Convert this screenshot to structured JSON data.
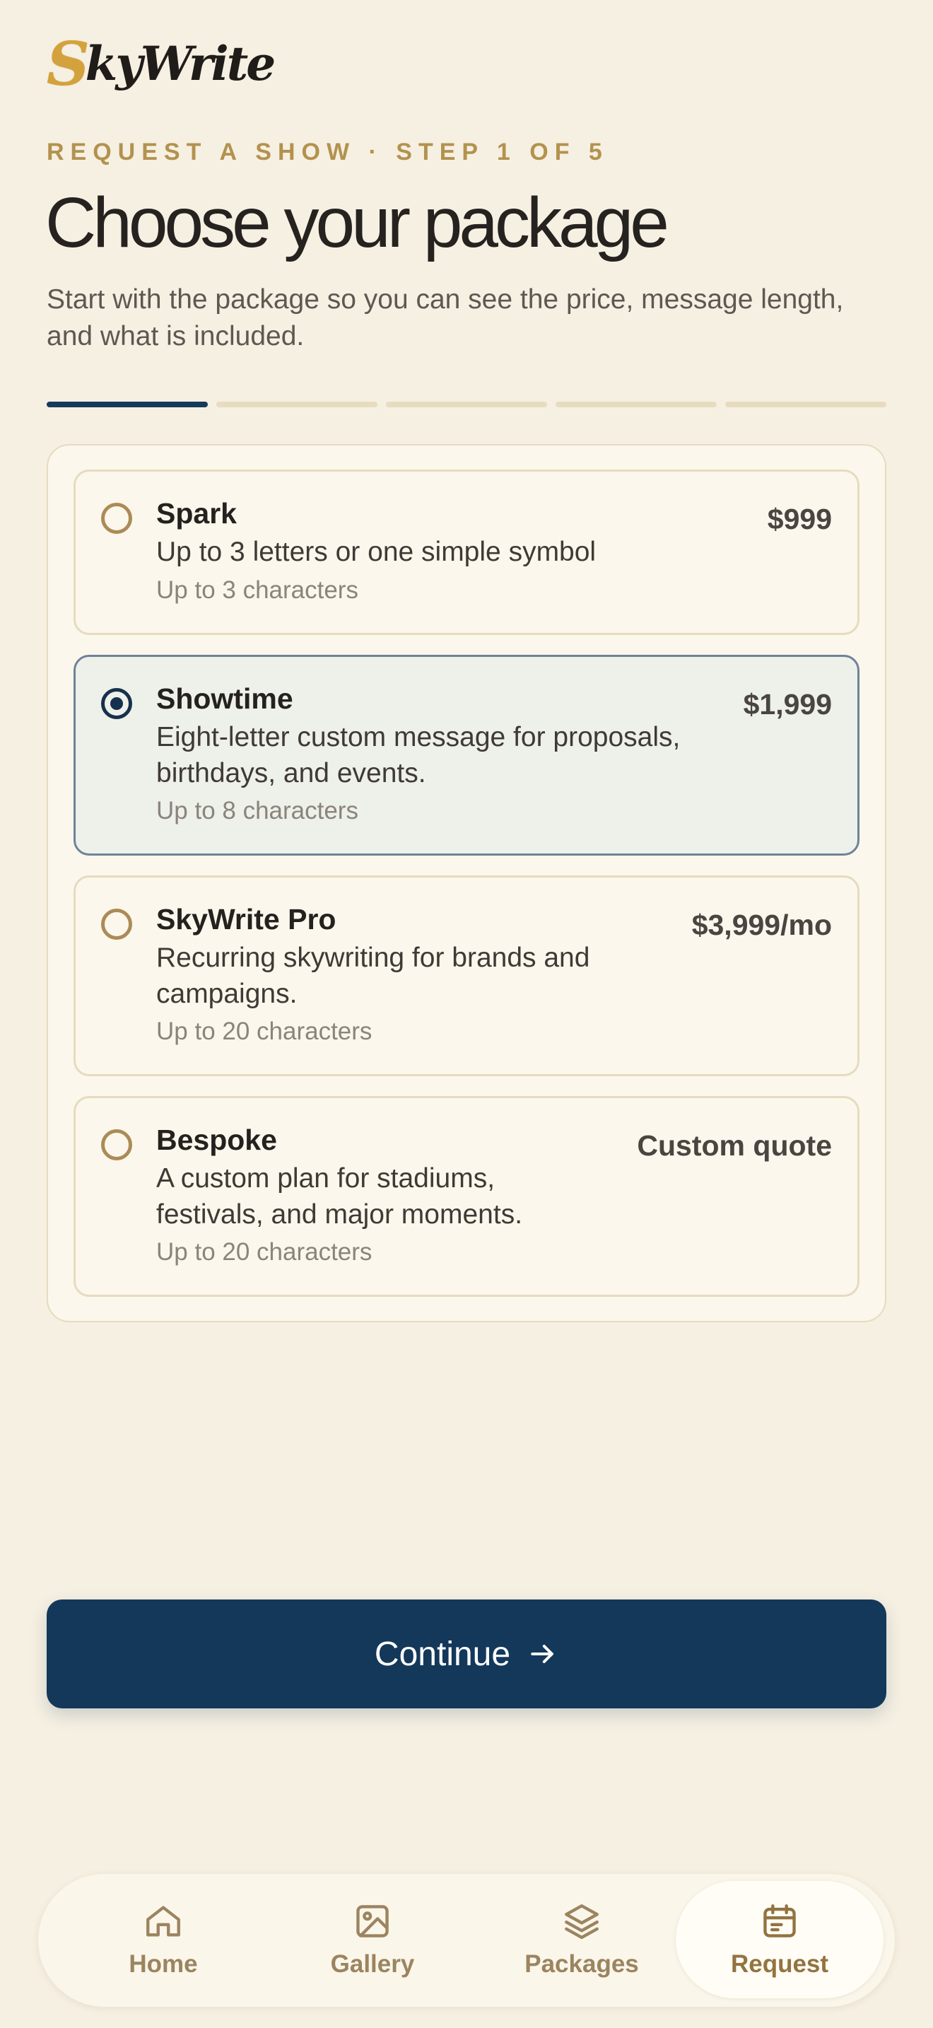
{
  "brand": {
    "logo_first": "S",
    "logo_rest": "kyWrite"
  },
  "header": {
    "eyebrow": "REQUEST A SHOW · STEP 1 OF 5",
    "title": "Choose your package",
    "subtitle": "Start with the package so you can see the price, message length, and what is included."
  },
  "progress": {
    "current_step": 1,
    "total_steps": 5
  },
  "packages": [
    {
      "name": "Spark",
      "description": "Up to 3 letters or one simple symbol",
      "characters": "Up to 3 characters",
      "price": "$999",
      "selected": false
    },
    {
      "name": "Showtime",
      "description": "Eight-letter custom message for proposals, birthdays, and events.",
      "characters": "Up to 8 characters",
      "price": "$1,999",
      "selected": true
    },
    {
      "name": "SkyWrite Pro",
      "description": "Recurring skywriting for brands and campaigns.",
      "characters": "Up to 20 characters",
      "price": "$3,999/mo",
      "selected": false
    },
    {
      "name": "Bespoke",
      "description": "A custom plan for stadiums, festivals, and major moments.",
      "characters": "Up to 20 characters",
      "price": "Custom quote",
      "selected": false
    }
  ],
  "actions": {
    "continue_label": "Continue",
    "continue_icon": "arrow-right-icon"
  },
  "nav": {
    "items": [
      {
        "label": "Home",
        "icon": "home-icon",
        "active": false
      },
      {
        "label": "Gallery",
        "icon": "image-icon",
        "active": false
      },
      {
        "label": "Packages",
        "icon": "layers-icon",
        "active": false
      },
      {
        "label": "Request",
        "icon": "calendar-icon",
        "active": true
      }
    ]
  },
  "colors": {
    "background": "#f6f0e2",
    "accent_navy": "#13385a",
    "accent_gold": "#b3924f"
  }
}
